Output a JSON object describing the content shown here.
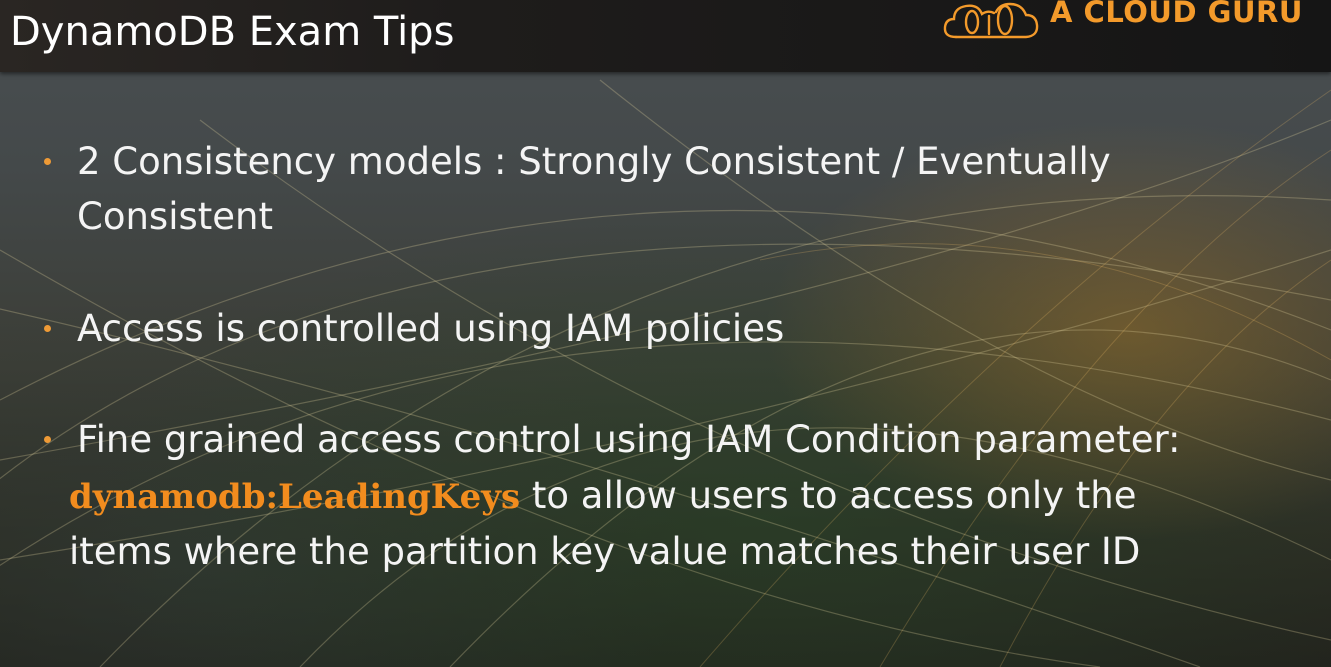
{
  "header": {
    "title": "DynamoDB Exam Tips",
    "logo_text": "A CLOUD GURU"
  },
  "bullets": [
    {
      "lines": [
        "2 Consistency models : Strongly Consistent / Eventually",
        "Consistent"
      ]
    },
    {
      "lines": [
        "Access is controlled using IAM policies"
      ]
    },
    {
      "line1": "Fine grained access control using IAM Condition parameter:",
      "code": "dynamodb:LeadingKeys",
      "line2_rest": " to allow users to access only the",
      "line3": "items where the partition key value matches their user ID"
    }
  ],
  "colors": {
    "accent": "#f39a2b",
    "bullet_dot": "#ee9a36",
    "code_text": "#f28c1e",
    "text": "#f4f4f4"
  },
  "icons": {
    "logo": "cloud-logo-icon",
    "bullet": "bullet-dot-icon"
  }
}
